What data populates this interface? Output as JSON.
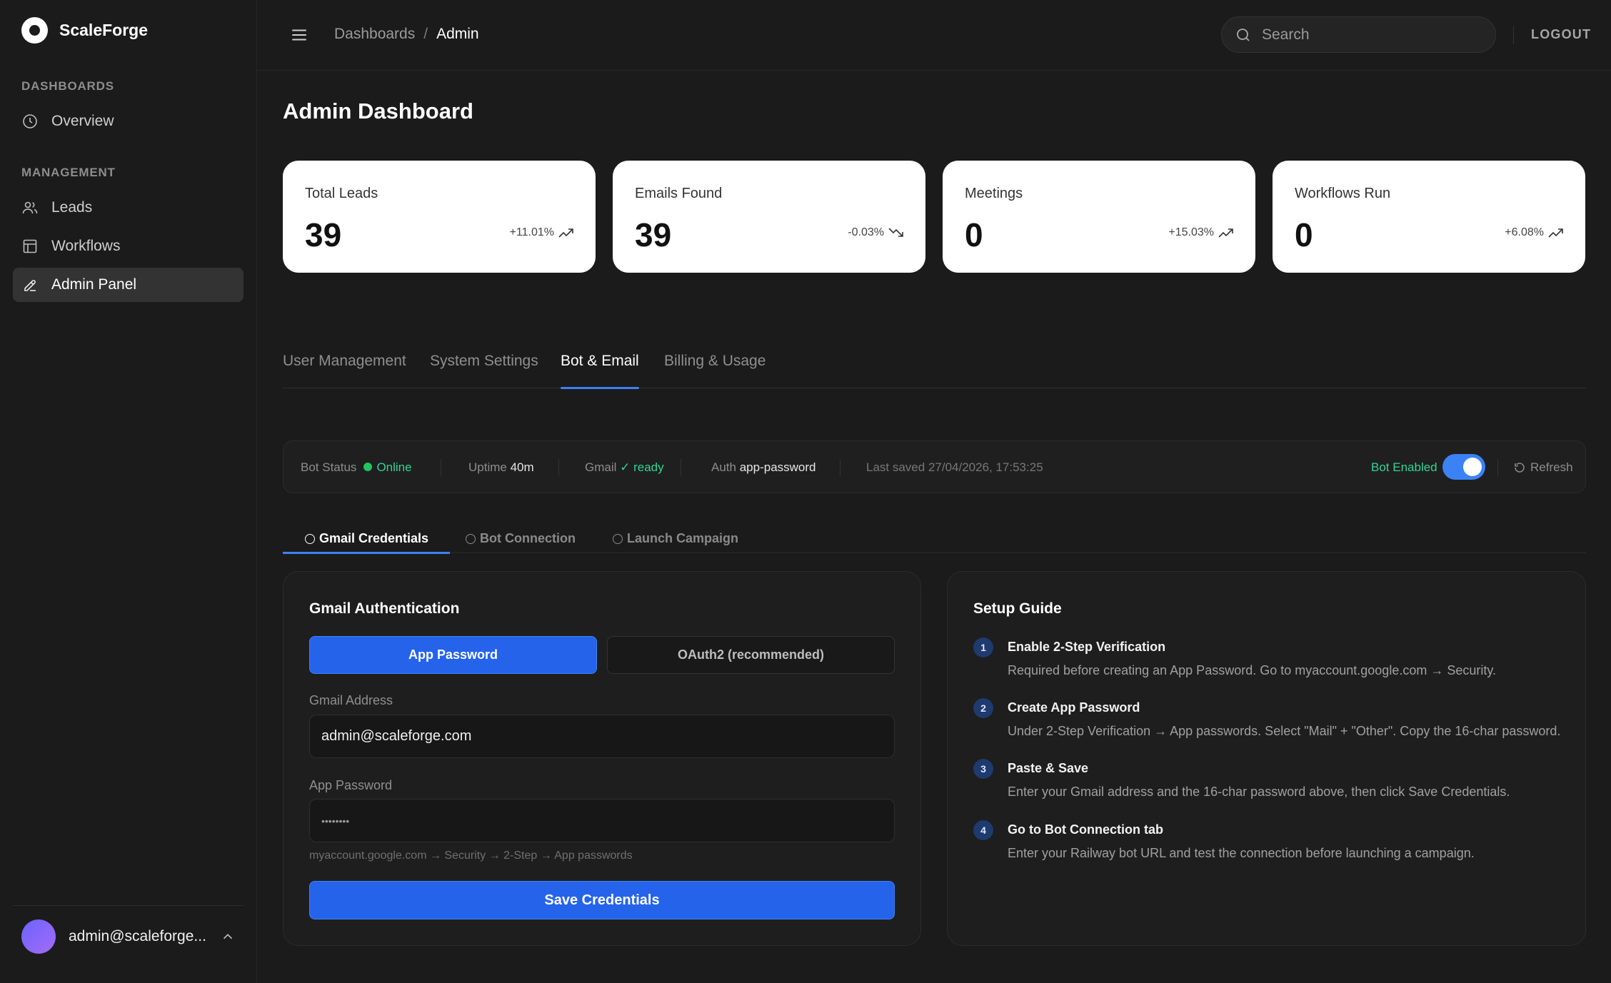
{
  "brand": {
    "name": "ScaleForge"
  },
  "sidebar": {
    "sections": [
      {
        "title": "DASHBOARDS"
      },
      {
        "title": "MANAGEMENT"
      }
    ],
    "items": [
      {
        "label": "Overview",
        "icon": "clock-icon"
      },
      {
        "label": "Leads",
        "icon": "users-icon"
      },
      {
        "label": "Workflows",
        "icon": "layout-icon"
      },
      {
        "label": "Admin Panel",
        "icon": "pen-icon",
        "active": true
      }
    ],
    "user": {
      "email": "admin@scaleforge..."
    }
  },
  "header": {
    "breadcrumb": [
      "Dashboards",
      "/",
      "Admin"
    ],
    "search_placeholder": "Search",
    "logout_label": "LOGOUT"
  },
  "page": {
    "title": "Admin Dashboard"
  },
  "stats": [
    {
      "label": "Total Leads",
      "value": "39",
      "change": "+11.01%",
      "trend": "up"
    },
    {
      "label": "Emails Found",
      "value": "39",
      "change": "-0.03%",
      "trend": "down"
    },
    {
      "label": "Meetings",
      "value": "0",
      "change": "+15.03%",
      "trend": "up"
    },
    {
      "label": "Workflows Run",
      "value": "0",
      "change": "+6.08%",
      "trend": "up"
    }
  ],
  "tabs": [
    {
      "label": "User Management"
    },
    {
      "label": "System Settings"
    },
    {
      "label": "Bot & Email",
      "active": true
    },
    {
      "label": "Billing & Usage"
    }
  ],
  "status": {
    "bot_status_label": "Bot Status",
    "bot_status_value": "Online",
    "uptime_label": "Uptime",
    "uptime_value": "40m",
    "gmail_label": "Gmail",
    "gmail_value": "✓ ready",
    "auth_label": "Auth",
    "auth_value": "app-password",
    "last_saved": "Last saved 27/04/2026, 17:53:25",
    "bot_enabled_label": "Bot Enabled",
    "bot_enabled": true,
    "refresh_label": "Refresh"
  },
  "subtabs": [
    {
      "label": "Gmail Credentials",
      "active": true
    },
    {
      "label": "Bot Connection"
    },
    {
      "label": "Launch Campaign"
    }
  ],
  "gmail_auth": {
    "title": "Gmail Authentication",
    "mode_app_password": "App Password",
    "mode_oauth": "OAuth2 (recommended)",
    "email_label": "Gmail Address",
    "email_value": "admin@scaleforge.com",
    "password_label": "App Password",
    "password_value": "••••••••",
    "hint": "myaccount.google.com → Security → 2-Step → App passwords",
    "save_label": "Save Credentials"
  },
  "setup_guide": {
    "title": "Setup Guide",
    "steps": [
      {
        "num": "1",
        "title": "Enable 2-Step Verification",
        "desc": "Required before creating an App Password. Go to myaccount.google.com → Security."
      },
      {
        "num": "2",
        "title": "Create App Password",
        "desc": "Under 2-Step Verification → App passwords. Select \"Mail\" + \"Other\". Copy the 16-char password."
      },
      {
        "num": "3",
        "title": "Paste & Save",
        "desc": "Enter your Gmail address and the 16-char password above, then click Save Credentials."
      },
      {
        "num": "4",
        "title": "Go to Bot Connection tab",
        "desc": "Enter your Railway bot URL and test the connection before launching a campaign."
      }
    ]
  },
  "colors": {
    "accent": "#2563eb",
    "online": "#22c55e",
    "background": "#1b1b1b"
  }
}
